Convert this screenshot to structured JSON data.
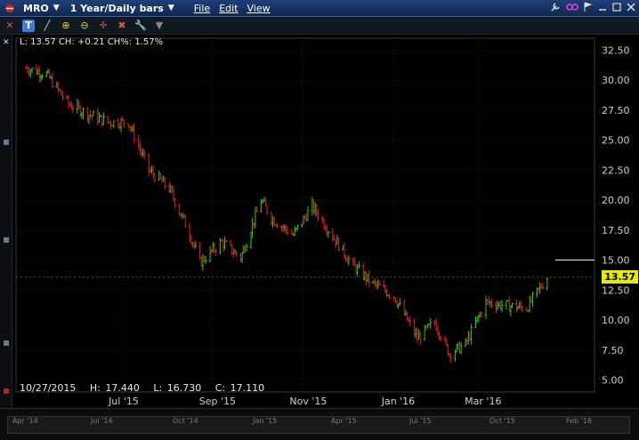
{
  "menubar": {
    "symbol": "MRO",
    "period": "1 Year/Daily bars",
    "menus": [
      "File",
      "Edit",
      "View"
    ]
  },
  "toolbar": {
    "icons": [
      "text-tool-icon",
      "draw-line-icon",
      "zoom-in-icon",
      "zoom-out-icon",
      "crosshair-icon",
      "delete-icon",
      "settings-icon",
      "dropdown-icon"
    ],
    "active_label": "T"
  },
  "info_line": "L: 13.57 CH: +0.21 CH%: 1.57%",
  "ohlc": {
    "date": "10/27/2015",
    "high": "H: 17.440",
    "low": "L: 16.730",
    "close": "C: 17.110"
  },
  "last_price_tag": "13.57",
  "colors": {
    "up": "#22cc22",
    "down": "#e02020",
    "tag": "#e8e800",
    "grid": "#2a2a2a"
  },
  "chart_data": {
    "type": "line",
    "title": "",
    "xlabel": "",
    "ylabel": "",
    "ylim": [
      4.0,
      33.5
    ],
    "y_ticks": [
      "32.50",
      "30.00",
      "27.50",
      "25.00",
      "22.50",
      "20.00",
      "17.50",
      "15.00",
      "12.50",
      "10.00",
      "7.50",
      "5.00"
    ],
    "x_ticks": [
      "Jul '15",
      "Sep '15",
      "Nov '15",
      "Jan '16",
      "Mar '16"
    ],
    "series": [
      {
        "x": [
          "2015-04-27",
          "2015-05-11",
          "2015-05-26",
          "2015-06-08",
          "2015-06-22",
          "2015-07-06",
          "2015-07-20",
          "2015-08-03",
          "2015-08-17",
          "2015-08-24",
          "2015-09-08",
          "2015-09-21",
          "2015-10-05",
          "2015-10-12",
          "2015-10-27",
          "2015-11-09",
          "2015-11-23",
          "2015-12-07",
          "2015-12-21",
          "2016-01-04",
          "2016-01-20",
          "2016-02-01",
          "2016-02-11",
          "2016-02-22",
          "2016-03-07",
          "2016-03-21",
          "2016-04-04",
          "2016-04-18"
        ],
        "values": [
          31.0,
          30.5,
          28.0,
          27.2,
          26.5,
          26.5,
          22.5,
          21.0,
          17.2,
          14.8,
          16.5,
          15.2,
          20.0,
          18.5,
          17.1,
          19.5,
          17.0,
          14.5,
          13.0,
          12.0,
          8.5,
          9.8,
          7.2,
          8.0,
          11.5,
          11.2,
          11.0,
          13.57
        ]
      }
    ]
  },
  "overview": {
    "labels": [
      "Apr '14",
      "Jul '14",
      "Oct '14",
      "Jan '15",
      "Apr '15",
      "Jul '15",
      "Oct '15",
      "Feb '16"
    ]
  }
}
